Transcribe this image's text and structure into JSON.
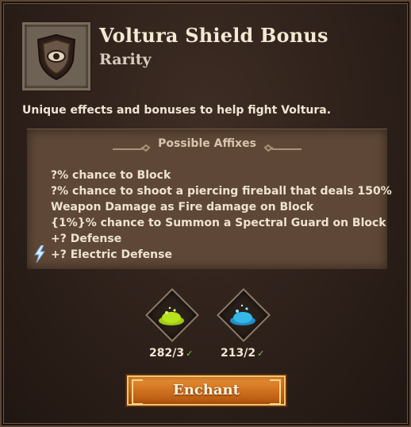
{
  "item": {
    "title": "Voltura Shield Bonus",
    "subtitle": "Rarity",
    "icon": "shield-eye-icon"
  },
  "description": "Unique effects and bonuses to help fight Voltura.",
  "affixes": {
    "header": "Possible Affixes",
    "lines": [
      "?% chance to Block",
      "?% chance to shoot a piercing fireball that deals 150%",
      "Weapon Damage as Fire damage on Block",
      "{1%}% chance to Summon a Spectral Guard on Block",
      "+? Defense",
      "+? Electric Defense"
    ],
    "electric_icon": "lightning-bolt-icon"
  },
  "materials": [
    {
      "icon": "green-dust-icon",
      "count": "282/3",
      "color": "#b6e21e"
    },
    {
      "icon": "blue-dust-icon",
      "count": "213/2",
      "color": "#35b8e8"
    }
  ],
  "enchant_label": "Enchant"
}
